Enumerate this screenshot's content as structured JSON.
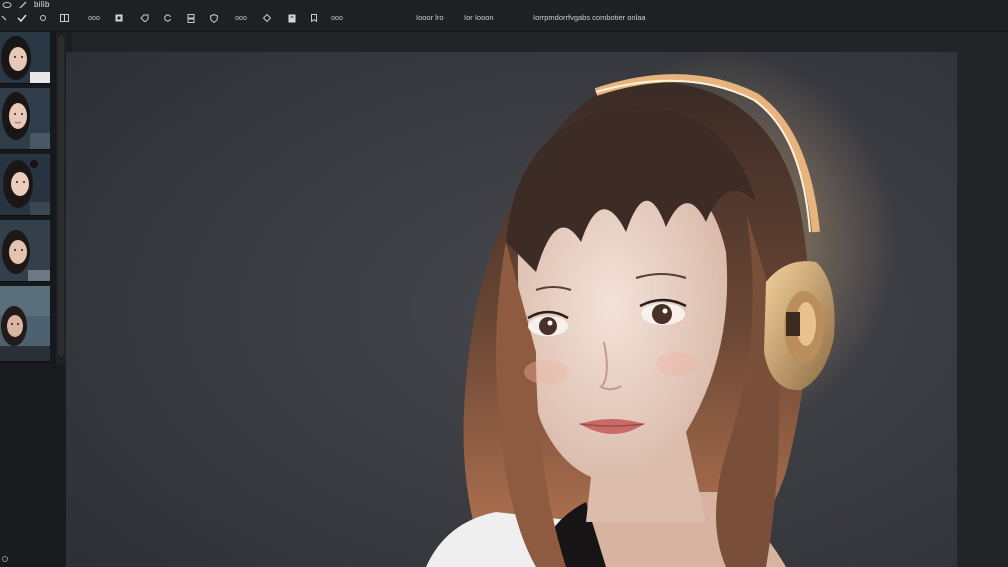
{
  "app": {
    "title": "bilib"
  },
  "toolbar": {
    "items": [
      {
        "name": "tool-a-button",
        "label": "ooo"
      },
      {
        "name": "tool-b-button",
        "label": "ooo"
      },
      {
        "name": "tool-c-button",
        "label": "ooo"
      }
    ],
    "text_buttons": [
      {
        "label": "Iooor lro"
      },
      {
        "label": "Ior Iooon"
      }
    ],
    "caption": "Iorrpmdorrfvgabs combotier onlaa"
  },
  "filmstrip": {
    "thumbnails": [
      {
        "label": "thumbnail 1"
      },
      {
        "label": "thumbnail 2"
      },
      {
        "label": "thumbnail 3"
      },
      {
        "label": "thumbnail 4"
      },
      {
        "label": "thumbnail 5"
      }
    ]
  },
  "colors": {
    "background": "#1c1d21",
    "canvas_bg": "#3a3b40",
    "accent_glow": "#e9b47a"
  }
}
